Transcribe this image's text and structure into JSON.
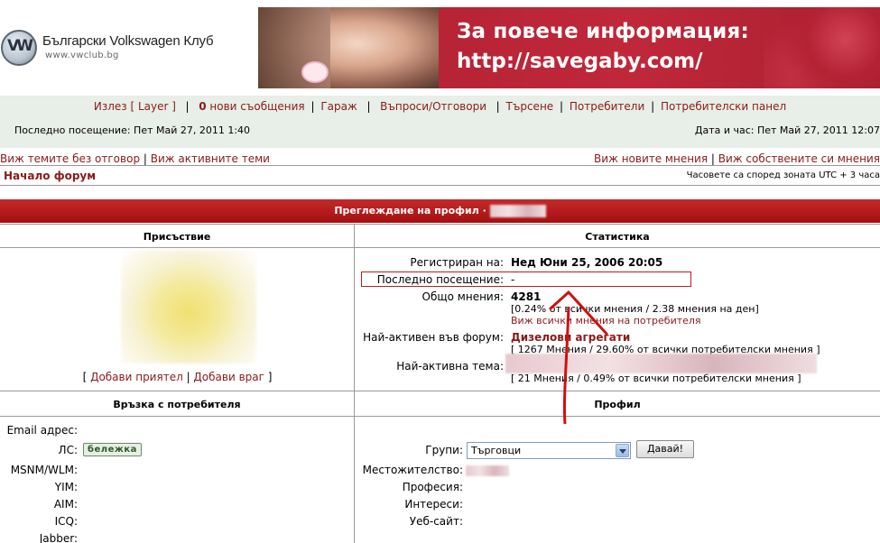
{
  "header": {
    "logo_title": "Български Volkswagen Клуб",
    "logo_url": "www.vwclub.bg",
    "banner_line1": "За повече информация:",
    "banner_line2": "http://savegaby.com/"
  },
  "topnav": {
    "logout": "Излез [ Layer ]",
    "messages_count": "0",
    "messages_label": " нови съобщения",
    "garage": "Гараж",
    "faq": "Въпроси/Отговори",
    "search": "Търсене",
    "users": "Потребители",
    "user_panel": "Потребителски панел"
  },
  "last_visit": "Последно посещение: Пет Май 27, 2011 1:40",
  "datetime": "Дата и час: Пет Май 27, 2011 12:07",
  "links": {
    "unanswered": "Виж темите без отговор",
    "active": "Виж активните теми",
    "new_posts": "Виж новите мнения",
    "own_posts": "Виж собствените си мнения"
  },
  "forum_home": "Начало форум",
  "timezone": "Часовете са според зоната UTC + 3 часа",
  "profile": {
    "heading": "Преглеждане на профил · ",
    "presence_header": "Присъствие",
    "stats_header": "Статистика",
    "add_friend": "Добави приятел",
    "add_foe": "Добави враг",
    "stats": {
      "registered_label": "Регистриран на:",
      "registered_value": "Нед Юни 25, 2006 20:05",
      "last_visit_label": "Последно посещение:",
      "last_visit_value": "-",
      "posts_label": "Общо мнения:",
      "posts_value": "4281",
      "posts_sub": "[0.24% от всички мнения / 2.38 мнения на ден]",
      "posts_link": "Виж всички мнения на потребителя",
      "forum_label": "Най-активен във форум:",
      "forum_value": "Дизелови агрегати",
      "forum_sub": "[ 1267 Мнения / 29.60% от всички потребителски мнения ]",
      "topic_label": "Най-активна тема:",
      "topic_sub": "[ 21 Мнения / 0.49% от всички потребителски мнения ]"
    },
    "contact_header": "Връзка с потребителя",
    "profile_header": "Профил",
    "contact": {
      "email": "Email адрес:",
      "pm": "ЛС:",
      "pm_badge": "бележка",
      "msnm": "MSNM/WLM:",
      "yim": "YIM:",
      "aim": "AIM:",
      "icq": "ICQ:",
      "jabber": "Jabber:"
    },
    "details": {
      "groups": "Групи:",
      "groups_value": "Търговци",
      "go_button": "Давай!",
      "location": "Местожителство:",
      "occupation": "Професия:",
      "interests": "Интереси:",
      "website": "Уеб-сайт:"
    }
  }
}
